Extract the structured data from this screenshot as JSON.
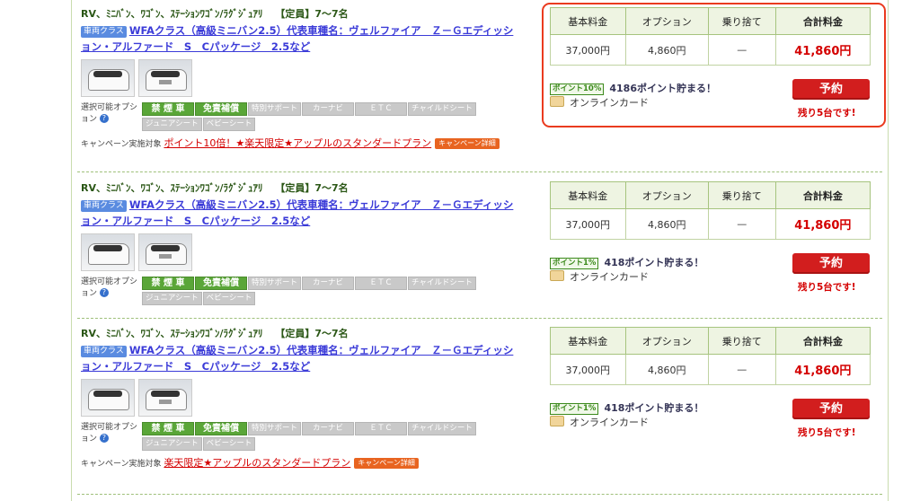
{
  "listings": [
    {
      "category": "RV、ﾐﾆﾊﾞﾝ、ﾜｺﾞﾝ、ｽﾃｰｼｮﾝﾜｺﾞﾝ/ﾗｸﾞｼﾞｭｱﾘ",
      "capacity": "【定員】7〜7名",
      "class_badge": "車両クラス",
      "title_line1": "WFAクラス（高級ミニバン2.5）代表車種名：ヴェルファイア　Ｚ－Ｇエディッシ",
      "title_line2": "ョン・アルファード　S　Cパッケージ　2.5など",
      "options_label": "選択可能オプション",
      "options": [
        "禁 煙 車",
        "免責補償",
        "特別サポート",
        "カーナビ",
        "ＥＴＣ",
        "チャイルドシート",
        "ジュニアシート",
        "ベビーシート"
      ],
      "campaign_label": "キャンペーン実施対象",
      "campaign_text": "ポイント10倍！★楽天限定★アップルのスタンダードプラン",
      "campaign_button": "キャンペーン詳細",
      "price_headers": [
        "基本料金",
        "オプション",
        "乗り捨て",
        "合計料金"
      ],
      "price_values": [
        "37,000円",
        "4,860円",
        "—",
        "41,860円"
      ],
      "point_badge": "ポイント10%",
      "points_text": "4186ポイント貯まる！",
      "payment": "オンラインカード",
      "reserve_label": "予約",
      "remaining": "残り5台です!"
    },
    {
      "category": "RV、ﾐﾆﾊﾞﾝ、ﾜｺﾞﾝ、ｽﾃｰｼｮﾝﾜｺﾞﾝ/ﾗｸﾞｼﾞｭｱﾘ",
      "capacity": "【定員】7〜7名",
      "class_badge": "車両クラス",
      "title_line1": "WFAクラス（高級ミニバン2.5）代表車種名：ヴェルファイア　Ｚ－Ｇエディッシ",
      "title_line2": "ョン・アルファード　S　Cパッケージ　2.5など",
      "options_label": "選択可能オプション",
      "options": [
        "禁 煙 車",
        "免責補償",
        "特別サポート",
        "カーナビ",
        "ＥＴＣ",
        "チャイルドシート",
        "ジュニアシート",
        "ベビーシート"
      ],
      "price_headers": [
        "基本料金",
        "オプション",
        "乗り捨て",
        "合計料金"
      ],
      "price_values": [
        "37,000円",
        "4,860円",
        "—",
        "41,860円"
      ],
      "point_badge": "ポイント1%",
      "points_text": "418ポイント貯まる！",
      "payment": "オンラインカード",
      "reserve_label": "予約",
      "remaining": "残り5台です!"
    },
    {
      "category": "RV、ﾐﾆﾊﾞﾝ、ﾜｺﾞﾝ、ｽﾃｰｼｮﾝﾜｺﾞﾝ/ﾗｸﾞｼﾞｭｱﾘ",
      "capacity": "【定員】7〜7名",
      "class_badge": "車両クラス",
      "title_line1": "WFAクラス（高級ミニバン2.5）代表車種名：ヴェルファイア　Ｚ－Ｇエディッシ",
      "title_line2": "ョン・アルファード　S　Cパッケージ　2.5など",
      "options_label": "選択可能オプション",
      "options": [
        "禁 煙 車",
        "免責補償",
        "特別サポート",
        "カーナビ",
        "ＥＴＣ",
        "チャイルドシート",
        "ジュニアシート",
        "ベビーシート"
      ],
      "campaign_label": "キャンペーン実施対象",
      "campaign_text": "楽天限定★アップルのスタンダードプラン",
      "campaign_button": "キャンペーン詳細",
      "price_headers": [
        "基本料金",
        "オプション",
        "乗り捨て",
        "合計料金"
      ],
      "price_values": [
        "37,000円",
        "4,860円",
        "—",
        "41,860円"
      ],
      "point_badge": "ポイント1%",
      "points_text": "418ポイント貯まる！",
      "payment": "オンラインカード",
      "reserve_label": "予約",
      "remaining": "残り5台です!"
    }
  ],
  "colors": {
    "total_price": "#d40000",
    "reserve_button": "#d21e1e",
    "option_enabled": "#5aa638",
    "option_disabled": "#c9c9c9",
    "highlight": "#ea3b1f"
  }
}
